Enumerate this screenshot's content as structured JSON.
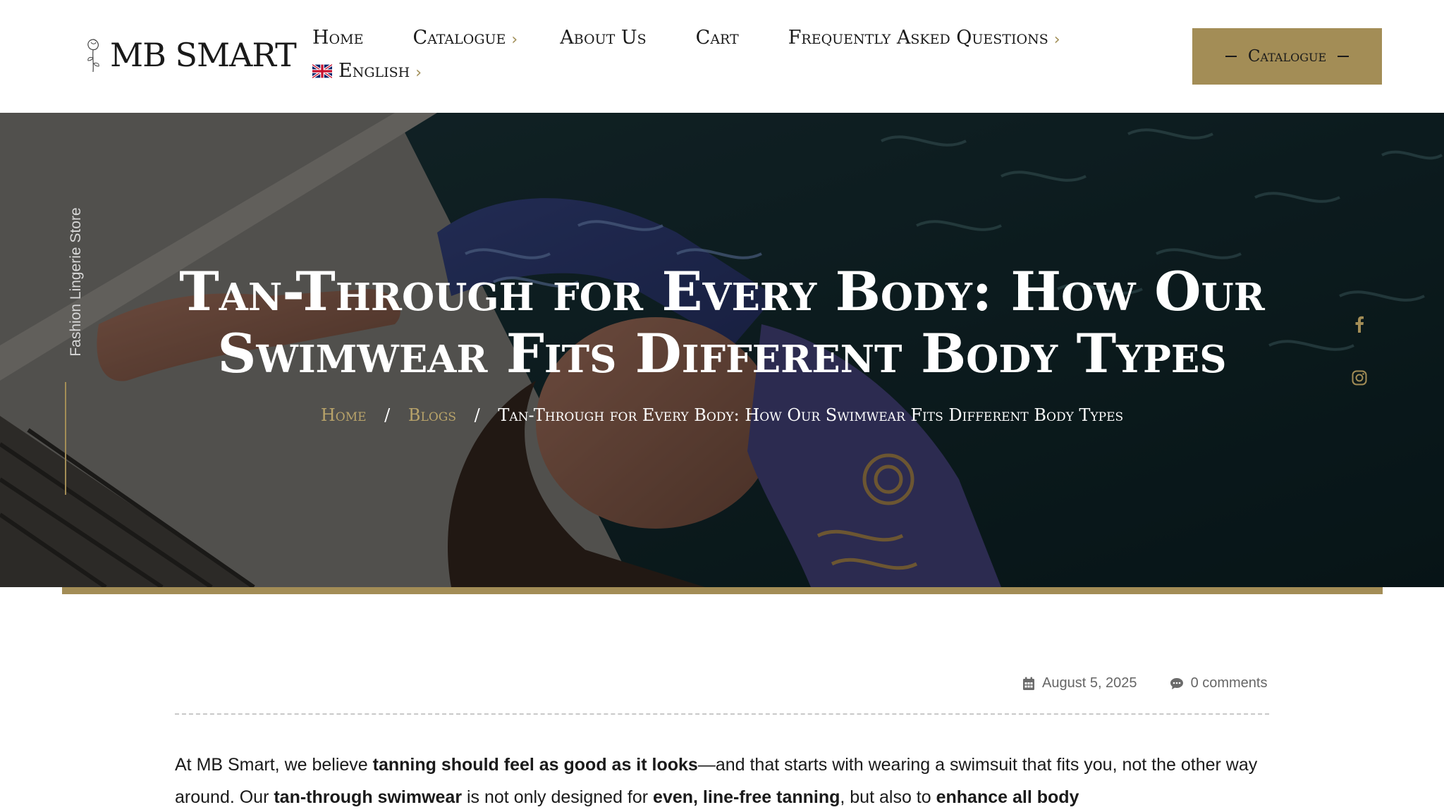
{
  "header": {
    "logo_text": "MB SMART",
    "nav": {
      "home": "Home",
      "catalogue": "Catalogue",
      "about": "About Us",
      "cart": "Cart",
      "faq": "Frequently Asked Questions",
      "language": "English"
    },
    "cta_label": "Catalogue"
  },
  "hero": {
    "side_text": "Fashion Lingerie Store",
    "title_line1": "Tan-Through for Every Body: How Our",
    "title_line2": "Swimwear Fits Different Body Types",
    "breadcrumb": {
      "home": "Home",
      "blogs": "Blogs",
      "current": "Tan-Through for Every Body: How Our Swimwear Fits Different Body Types",
      "separator": "/"
    }
  },
  "meta": {
    "date": "August 5, 2025",
    "comments": "0 comments"
  },
  "article": {
    "p1_a": "At MB Smart, we believe ",
    "p1_b": "tanning should feel as good as it looks",
    "p1_c": "—and that starts with wearing a swimsuit that fits you, not the other way around. Our ",
    "p1_d": "tan-through swimwear",
    "p1_e": " is not only designed for ",
    "p1_f": "even, line-free tanning",
    "p1_g": ", but also to ",
    "p1_h": "enhance all body"
  },
  "colors": {
    "accent_gold": "#a38d56",
    "text_dark": "#1a1a1a"
  }
}
